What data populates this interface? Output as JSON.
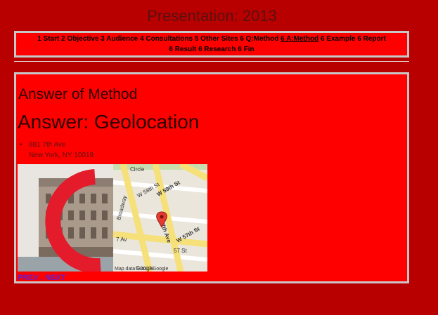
{
  "page_title": "Presentation: 2013",
  "nav": [
    {
      "label": "1 Start"
    },
    {
      "label": "2 Objective"
    },
    {
      "label": "3 Audience"
    },
    {
      "label": "4 Consultations"
    },
    {
      "label": "5 Other Sites"
    },
    {
      "label": "6 Q:Method"
    },
    {
      "label": "6 A:Method"
    },
    {
      "label": "6 Example"
    },
    {
      "label": "6 Report"
    },
    {
      "label": "6 Result"
    },
    {
      "label": "6 Research"
    },
    {
      "label": "6 Fin"
    }
  ],
  "section_heading": "Answer of Method",
  "answer_heading": "Answer: Geolocation",
  "address": {
    "line1": "881 7th Ave",
    "line2": "New York, NY 10019"
  },
  "map": {
    "streets": [
      "Circle",
      "W 58th St",
      "W 59th St",
      "Broadway",
      "7th Ave",
      "W 57th St",
      "7 Av",
      "57 St",
      "Google"
    ],
    "map_data": "Map data ©2013 Google"
  },
  "links": {
    "prev": "PREV",
    "sep": " . ",
    "next": "NEXT"
  }
}
